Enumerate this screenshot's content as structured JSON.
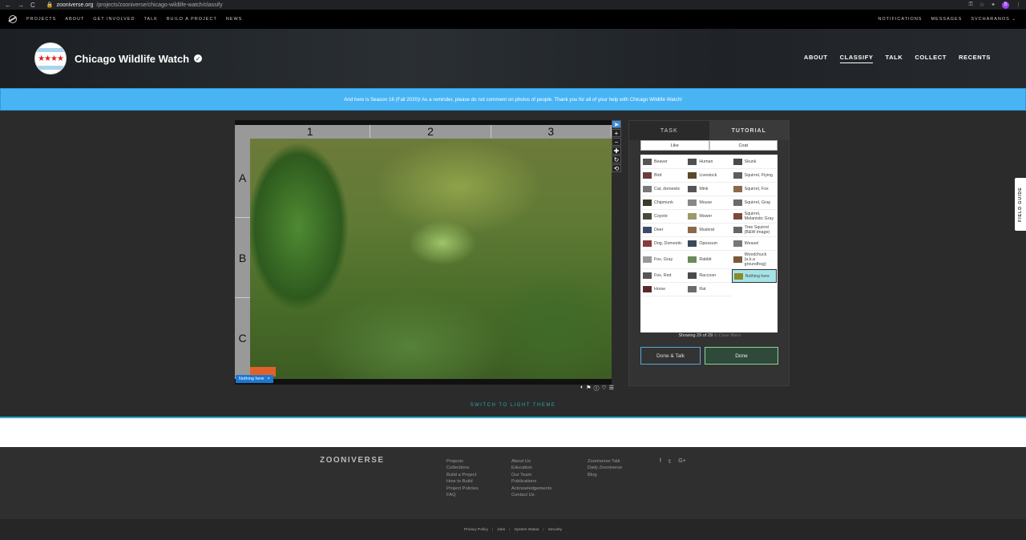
{
  "browser": {
    "url_host": "zooniverse.org",
    "url_path": "/projects/zooniverse/chicago-wildlife-watch/classify",
    "profile_initial": "S"
  },
  "topbar": {
    "links": [
      "PROJECTS",
      "ABOUT",
      "GET INVOLVED",
      "TALK",
      "BUILD A PROJECT",
      "NEWS"
    ],
    "right_links": [
      "NOTIFICATIONS",
      "MESSAGES",
      "SVCHARANOS ⌄"
    ]
  },
  "project": {
    "title": "Chicago Wildlife Watch",
    "stars": "★★★★",
    "nav": [
      "ABOUT",
      "CLASSIFY",
      "TALK",
      "COLLECT",
      "RECENTS"
    ]
  },
  "announcement": "And here is Season 16 (Fall 2020)! As a reminder, please do not comment on photos of people. Thank you for all of your help with Chicago Wildlife Watch!",
  "viewer": {
    "columns": [
      "1",
      "2",
      "3"
    ],
    "rows": [
      "A",
      "B",
      "C"
    ],
    "selected_tag": "Nothing here",
    "tag_close": "×"
  },
  "task": {
    "tabs": [
      "TASK",
      "TUTORIAL"
    ],
    "filters": [
      "Like",
      "Coat"
    ],
    "choices": [
      {
        "label": "Beaver",
        "color": "#555555"
      },
      {
        "label": "Human",
        "color": "#505050"
      },
      {
        "label": "Skunk",
        "color": "#4a4a4a"
      },
      {
        "label": "Bird",
        "color": "#6b3d3d"
      },
      {
        "label": "Livestock",
        "color": "#5a4a2a"
      },
      {
        "label": "Squirrel, Flying",
        "color": "#5d5d5d"
      },
      {
        "label": "Cat, domestic",
        "color": "#777777"
      },
      {
        "label": "Mink",
        "color": "#555555"
      },
      {
        "label": "Squirrel, Fox",
        "color": "#8a6a4a"
      },
      {
        "label": "Chipmunk",
        "color": "#3a3a2a"
      },
      {
        "label": "Mouse",
        "color": "#888888"
      },
      {
        "label": "Squirrel, Gray",
        "color": "#6a6a6a"
      },
      {
        "label": "Coyote",
        "color": "#4a4a3a"
      },
      {
        "label": "Mower",
        "color": "#9a9a6a"
      },
      {
        "label": "Squirrel, Melanistic Gray",
        "color": "#7a4a3a"
      },
      {
        "label": "Deer",
        "color": "#3a4a6a"
      },
      {
        "label": "Muskrat",
        "color": "#8a6a4a"
      },
      {
        "label": "Tree Squirrel (B&W image)",
        "color": "#666666"
      },
      {
        "label": "Dog, Domestic",
        "color": "#8a3a3a"
      },
      {
        "label": "Opossum",
        "color": "#3a4a5a"
      },
      {
        "label": "Weasel",
        "color": "#777777"
      },
      {
        "label": "Fox, Gray",
        "color": "#999999"
      },
      {
        "label": "Rabbit",
        "color": "#6a8a5a"
      },
      {
        "label": "Woodchuck (a.k.a groundhog)",
        "color": "#7a5a3a"
      },
      {
        "label": "Fox, Red",
        "color": "#555555"
      },
      {
        "label": "Raccoon",
        "color": "#4a4a4a"
      },
      {
        "label": "Nothing here",
        "color": "#8a8a2a",
        "selected": true
      },
      {
        "label": "Horse",
        "color": "#5a2a2a"
      },
      {
        "label": "Rat",
        "color": "#6a6a6a"
      }
    ],
    "showing_text": "Showing 29 of 29",
    "clear_filters": "⊘ Clear filters",
    "done_talk": "Done & Talk",
    "done": "Done"
  },
  "field_guide": "FIELD GUIDE",
  "switch_theme": "SWITCH TO LIGHT THEME",
  "footer": {
    "logo": "ZOONIVERSE",
    "col1": [
      "Projects",
      "Collections",
      "Build a Project",
      "How to Build",
      "Project Policies",
      "FAQ"
    ],
    "col2": [
      "About Us",
      "Education",
      "Our Team",
      "Publications",
      "Acknowledgements",
      "Contact Us"
    ],
    "col3": [
      "Zooniverse Talk",
      "Daily Zooniverse",
      "Blog"
    ],
    "social": [
      "f",
      "𝕥",
      "G+"
    ]
  },
  "legal": [
    "Privacy Policy",
    "Jobs",
    "System Status",
    "Security"
  ]
}
